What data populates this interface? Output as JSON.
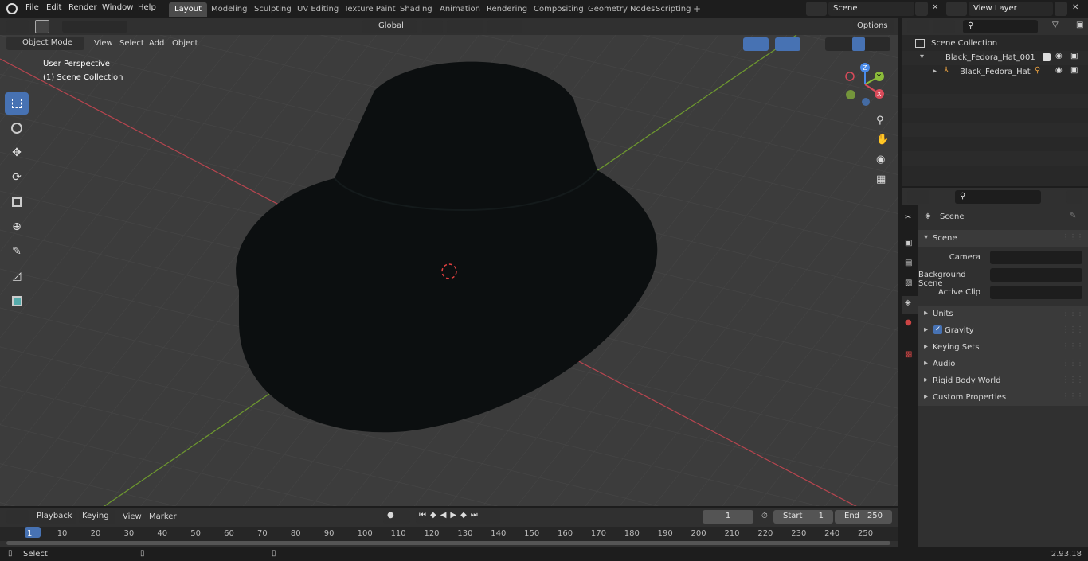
{
  "menu": {
    "items": [
      "File",
      "Edit",
      "Render",
      "Window",
      "Help"
    ]
  },
  "workspaces": [
    "Layout",
    "Modeling",
    "Sculpting",
    "UV Editing",
    "Texture Paint",
    "Shading",
    "Animation",
    "Rendering",
    "Compositing",
    "Geometry Nodes",
    "Scripting"
  ],
  "active_workspace": "Layout",
  "scene": {
    "name": "Scene",
    "view_layer": "View Layer"
  },
  "viewport": {
    "mode": "Object Mode",
    "menus": [
      "View",
      "Select",
      "Add",
      "Object"
    ],
    "orientation": "Global",
    "options": "Options",
    "overlay_line1": "User Perspective",
    "overlay_line2": "(1) Scene Collection"
  },
  "outliner": {
    "root": "Scene Collection",
    "items": [
      {
        "label": "Black_Fedora_Hat_001"
      },
      {
        "label": "Black_Fedora_Hat"
      }
    ]
  },
  "properties": {
    "header": "Scene",
    "panel": "Scene",
    "camera_label": "Camera",
    "bg_scene_label": "Background Scene",
    "active_clip_label": "Active Clip",
    "sections": [
      "Units",
      "Gravity",
      "Keying Sets",
      "Audio",
      "Rigid Body World",
      "Custom Properties"
    ]
  },
  "timeline": {
    "menus": [
      "Playback",
      "Keying",
      "View",
      "Marker"
    ],
    "current_frame": "1",
    "start_label": "Start",
    "start": "1",
    "end_label": "End",
    "end": "250",
    "ruler": [
      "1",
      "10",
      "20",
      "30",
      "40",
      "50",
      "60",
      "70",
      "80",
      "90",
      "100",
      "110",
      "120",
      "130",
      "140",
      "150",
      "160",
      "170",
      "180",
      "190",
      "200",
      "210",
      "220",
      "230",
      "240",
      "250"
    ]
  },
  "status": {
    "left": "Select",
    "version": "2.93.18"
  },
  "colors": {
    "accent": "#4772b3",
    "x_axis": "#d94b5a",
    "y_axis": "#8bbb3a",
    "z_axis": "#4a8ae8"
  }
}
